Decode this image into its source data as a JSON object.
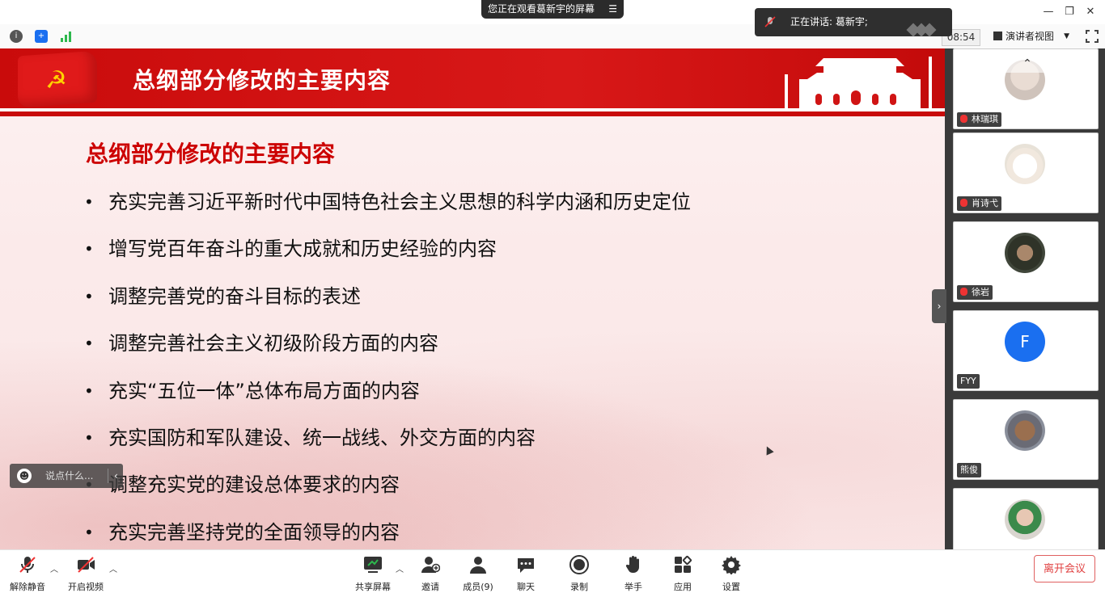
{
  "window": {
    "viewing_banner": "您正在观看葛新宇的屏幕",
    "speaking": "正在讲话: 葛新宇;"
  },
  "toolbar": {
    "time": "08:54",
    "view_label": "演讲者视图"
  },
  "slide": {
    "header_title": "总纲部分修改的主要内容",
    "subtitle": "总纲部分修改的主要内容",
    "bullets": [
      "充实完善习近平新时代中国特色社会主义思想的科学内涵和历史定位",
      "增写党百年奋斗的重大成就和历史经验的内容",
      "调整完善党的奋斗目标的表述",
      "调整完善社会主义初级阶段方面的内容",
      "充实“五位一体”总体布局方面的内容",
      "充实国防和军队建设、统一战线、外交方面的内容",
      "调整充实党的建设总体要求的内容",
      "充实完善坚持党的全面领导的内容"
    ]
  },
  "chat": {
    "placeholder": "说点什么..."
  },
  "participants": [
    {
      "name": "林瑞琪",
      "muted": true
    },
    {
      "name": "肖诗弋",
      "muted": true
    },
    {
      "name": "徐岩",
      "muted": true
    },
    {
      "name": "FYY",
      "muted": false,
      "initial": "F",
      "color": "#1a6ff0"
    },
    {
      "name": "熊俊",
      "muted": false
    },
    {
      "name": "",
      "muted": false
    }
  ],
  "bottom": {
    "unmute": "解除静音",
    "start_video": "开启视频",
    "share": "共享屏幕",
    "invite": "邀请",
    "members": "成员(9)",
    "chat": "聊天",
    "record": "录制",
    "raise_hand": "举手",
    "apps": "应用",
    "settings": "设置",
    "leave": "离开会议"
  },
  "colors": {
    "accent_red": "#c90b0b",
    "leave_red": "#e04040",
    "fyy_blue": "#1a6ff0"
  }
}
